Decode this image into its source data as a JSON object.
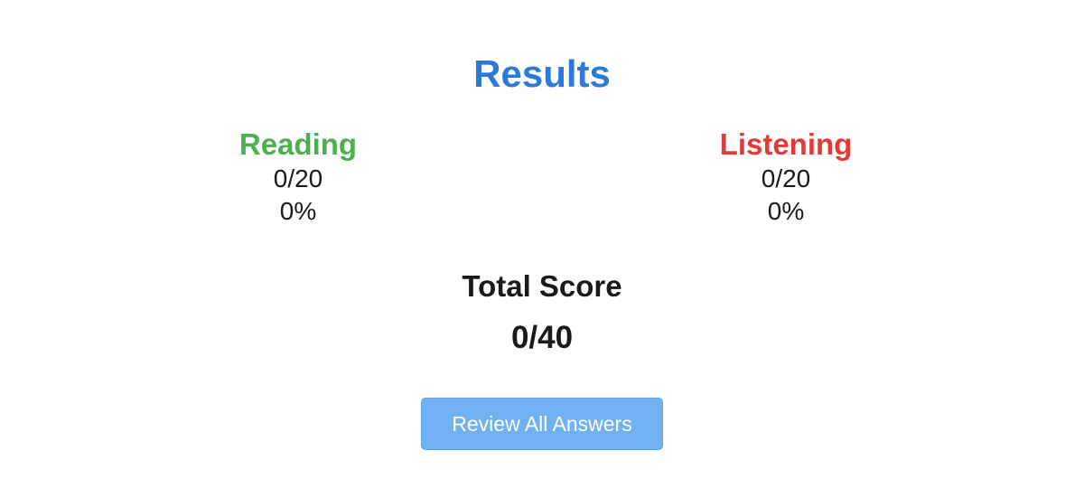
{
  "colors": {
    "title": "#2b7ad9",
    "reading": "#4caf50",
    "listening": "#e53935",
    "button_bg": "#70b1f3",
    "text": "#1a1a1a"
  },
  "header": {
    "title": "Results"
  },
  "sections": {
    "reading": {
      "title": "Reading",
      "score": "0/20",
      "percent": "0%"
    },
    "listening": {
      "title": "Listening",
      "score": "0/20",
      "percent": "0%"
    }
  },
  "total": {
    "label": "Total Score",
    "value": "0/40"
  },
  "actions": {
    "review_label": "Review All Answers"
  }
}
